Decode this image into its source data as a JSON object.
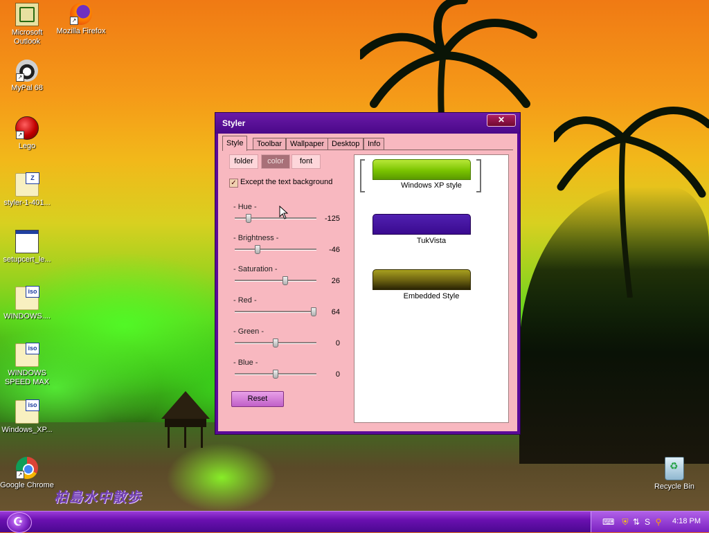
{
  "desktop": {
    "icons": [
      {
        "label": "Microsoft Outlook",
        "icon": "outlook-icon"
      },
      {
        "label": "Mozilla Firefox",
        "icon": "firefox-icon"
      },
      {
        "label": "MyPal 68",
        "icon": "mypal-icon"
      },
      {
        "label": "Lego",
        "icon": "lego-icon"
      },
      {
        "label": "styler-1-401...",
        "icon": "zip-file-icon"
      },
      {
        "label": "setupcert_le...",
        "icon": "setup-window-icon"
      },
      {
        "label": "WINDOWS....",
        "icon": "iso-file-icon"
      },
      {
        "label": "WINDOWS SPEED MAX",
        "icon": "iso-file-icon"
      },
      {
        "label": "Windows_XP...",
        "icon": "iso-file-icon"
      },
      {
        "label": "Google Chrome",
        "icon": "chrome-icon"
      },
      {
        "label": "Recycle Bin",
        "icon": "recycle-bin-icon"
      }
    ],
    "watermark": "柏島水中散歩"
  },
  "window": {
    "title": "Styler",
    "close_glyph": "✕",
    "tabs": [
      "Style",
      "Toolbar",
      "Wallpaper",
      "Desktop",
      "Info"
    ],
    "active_tab": "Style",
    "subtabs": [
      "folder",
      "color",
      "font"
    ],
    "active_subtab": "color",
    "checkbox": {
      "label": "Except the text background",
      "checked": true
    },
    "sliders": [
      {
        "label": "- Hue -",
        "value": "-125"
      },
      {
        "label": "- Brightness -",
        "value": "-46"
      },
      {
        "label": "- Saturation -",
        "value": "26"
      },
      {
        "label": "- Red -",
        "value": "64"
      },
      {
        "label": "- Green -",
        "value": "0"
      },
      {
        "label": "- Blue -",
        "value": "0"
      }
    ],
    "reset_label": "Reset",
    "styles": [
      {
        "label": "Windows XP style",
        "selected": true,
        "color": "#7ac400"
      },
      {
        "label": "TukVista",
        "selected": false,
        "color": "#3a0a90"
      },
      {
        "label": "Embedded Style",
        "selected": false,
        "color": "#6a6010"
      }
    ]
  },
  "taskbar": {
    "start_glyph": "☪",
    "clock": "4:18 PM"
  }
}
